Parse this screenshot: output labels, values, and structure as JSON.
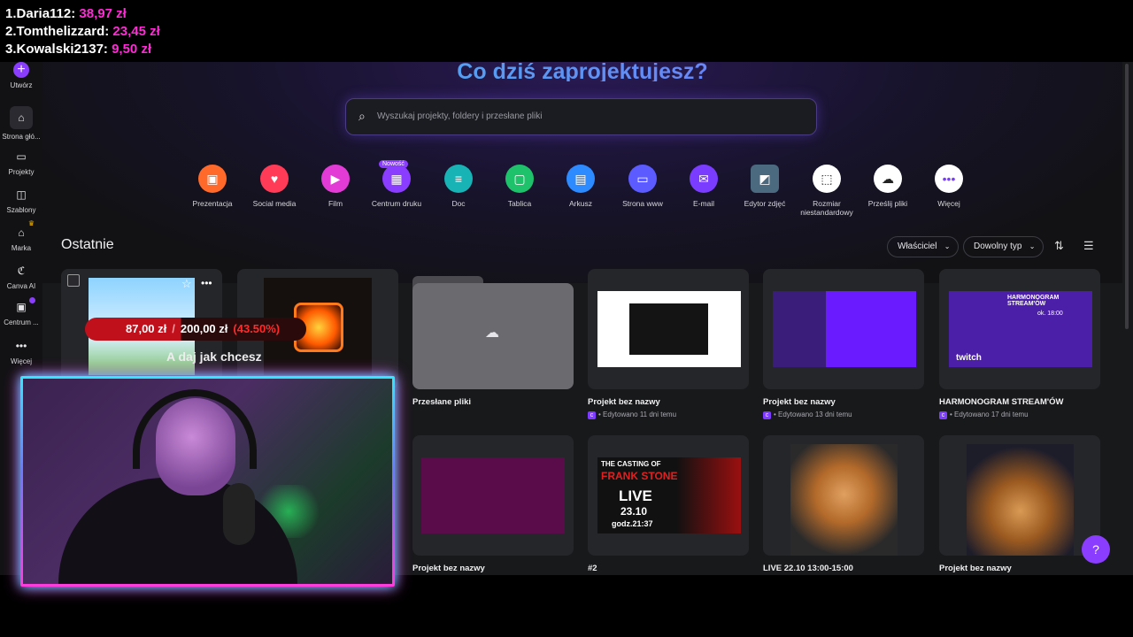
{
  "leaderboard": [
    {
      "rank": "1.",
      "name": "Daria112:",
      "amount": "38,97 zł"
    },
    {
      "rank": "2.",
      "name": "Tomthelizzard:",
      "amount": "23,45 zł"
    },
    {
      "rank": "3.",
      "name": "Kowalski2137:",
      "amount": "9,50 zł"
    }
  ],
  "sidebar": {
    "items": [
      {
        "label": "Utwórz",
        "icon": "plus-icon"
      },
      {
        "label": "Strona głó...",
        "icon": "home-icon"
      },
      {
        "label": "Projekty",
        "icon": "folder-icon"
      },
      {
        "label": "Szablony",
        "icon": "template-icon"
      },
      {
        "label": "Marka",
        "icon": "brand-icon"
      },
      {
        "label": "Canva AI",
        "icon": "ai-icon"
      },
      {
        "label": "Centrum ...",
        "icon": "print-icon"
      },
      {
        "label": "Więcej",
        "icon": "more-icon"
      }
    ]
  },
  "header": {
    "title": "Co dziś zaprojektujesz?",
    "search_placeholder": "Wyszukaj projekty, foldery i przesłane pliki"
  },
  "categories": [
    {
      "label": "Prezentacja",
      "color": "#ff6a2a",
      "icon": "presentation-icon"
    },
    {
      "label": "Social media",
      "color": "#ff3b57",
      "icon": "heart-icon"
    },
    {
      "label": "Film",
      "color": "#e33bd6",
      "icon": "video-icon"
    },
    {
      "label": "Centrum druku",
      "color": "#8b3dff",
      "icon": "print-icon",
      "badge": "Nowość"
    },
    {
      "label": "Doc",
      "color": "#17b3b5",
      "icon": "doc-icon"
    },
    {
      "label": "Tablica",
      "color": "#1ec26a",
      "icon": "whiteboard-icon"
    },
    {
      "label": "Arkusz",
      "color": "#2e8bff",
      "icon": "sheet-icon"
    },
    {
      "label": "Strona www",
      "color": "#5b5bff",
      "icon": "website-icon"
    },
    {
      "label": "E-mail",
      "color": "#7a3dff",
      "icon": "email-icon"
    },
    {
      "label": "Edytor zdjęć",
      "color": "#4b6a80",
      "icon": "photo-icon"
    },
    {
      "label": "Rozmiar niestandardowy",
      "color": "#ffffff",
      "icon": "custom-size-icon"
    },
    {
      "label": "Prześlij pliki",
      "color": "#ffffff",
      "icon": "upload-icon"
    },
    {
      "label": "Więcej",
      "color": "#ffffff",
      "icon": "more-icon"
    }
  ],
  "recent": {
    "title": "Ostatnie",
    "filters": [
      "Właściciel",
      "Dowolny typ"
    ],
    "cards": [
      {
        "label": "Przesłane pliki",
        "sub": ""
      },
      {
        "label": "Projekt bez nazwy",
        "sub": "• Edytowano 11 dni temu"
      },
      {
        "label": "Projekt bez nazwy",
        "sub": "• Edytowano 13 dni temu"
      },
      {
        "label": "HARMONOGRAM STREAM'ÓW",
        "sub": "• Edytowano 17 dni temu"
      },
      {
        "label": "Projekt bez nazwy",
        "sub": ""
      },
      {
        "label": "#2",
        "sub": ""
      },
      {
        "label": "LIVE 22.10 13:00-15:00",
        "sub": ""
      },
      {
        "label": "Projekt bez nazwy",
        "sub": ""
      }
    ],
    "thumb_texts": {
      "harmonogram_title": "HARMONOGRAM STREAM'ÓW",
      "harmonogram_time": "ok. 18:00",
      "twitch": "twitch",
      "casting_title": "THE CASTING OF",
      "casting_sub": "FRANK STONE",
      "live": "LIVE",
      "date": "23.10",
      "hour": "godz.21:37"
    }
  },
  "donation": {
    "current": "87,00 zł",
    "separator": "/",
    "goal": "200,00 zł",
    "percent": "(43.50%)",
    "progress": 0.435,
    "message": "A daj jak chcesz"
  },
  "help": {
    "label": "?"
  }
}
